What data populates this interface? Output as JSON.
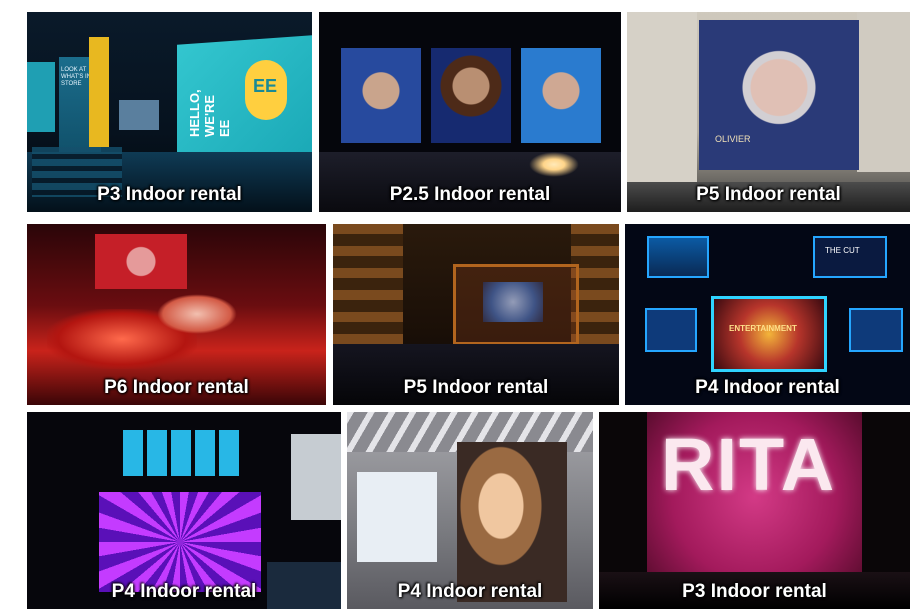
{
  "gallery": {
    "tiles": [
      {
        "caption": "P3 Indoor rental",
        "screen_text": "HELLO, WE'RE EE",
        "logo": "EE",
        "sign_text": "LOOK AT WHAT'S IN STORE"
      },
      {
        "caption": "P2.5 Indoor rental"
      },
      {
        "caption": "P5 Indoor rental",
        "screen_text": "OLIVIER"
      },
      {
        "caption": "P6 Indoor rental"
      },
      {
        "caption": "P5 Indoor rental"
      },
      {
        "caption": "P4 Indoor rental",
        "screen_text_left": "THE CUT",
        "screen_text_right": "ENTERTAINMENT"
      },
      {
        "caption": "P4 Indoor rental"
      },
      {
        "caption": "P4 Indoor rental"
      },
      {
        "caption": "P3 Indoor rental",
        "screen_text": "RITA"
      }
    ]
  },
  "colors": {
    "background": "#ffffff",
    "caption": "#ffffff"
  }
}
